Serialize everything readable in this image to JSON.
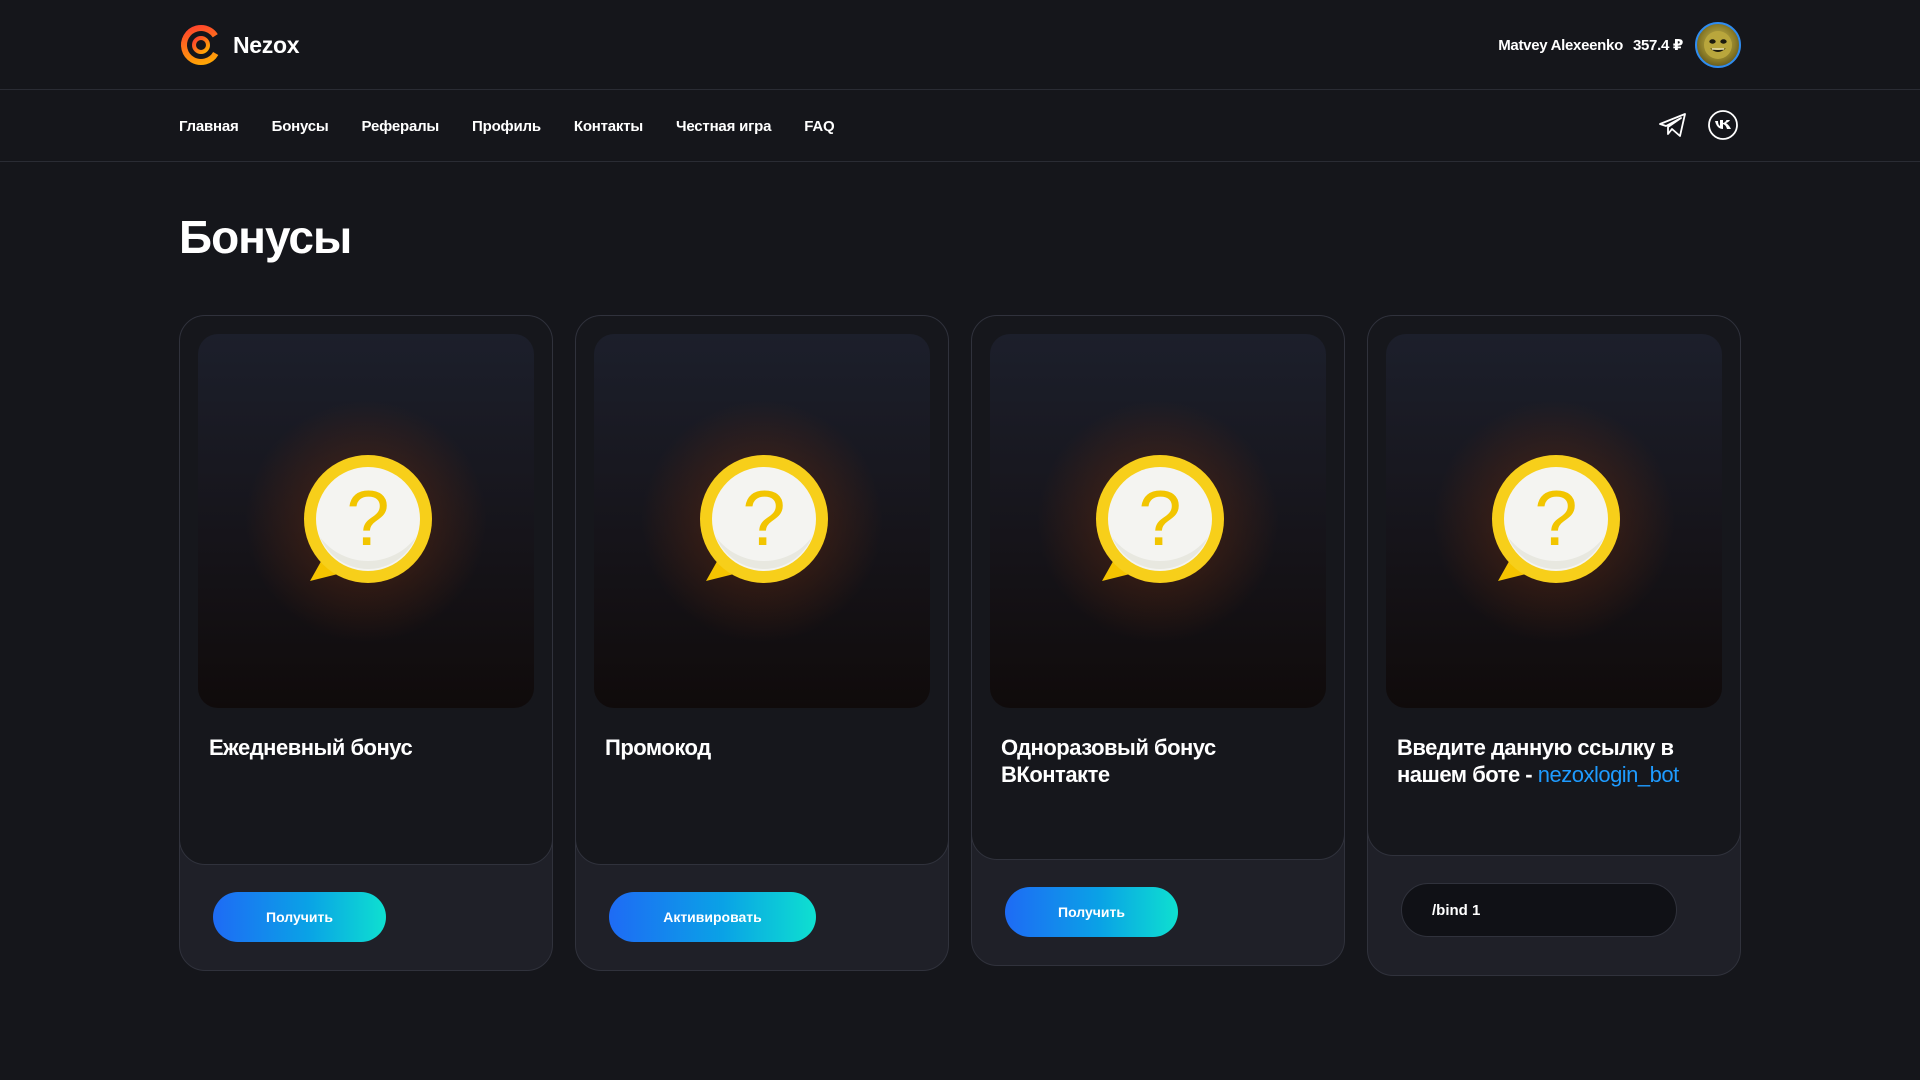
{
  "header": {
    "logo_text": "Nezox",
    "user_name": "Matvey Alexeenko",
    "balance": "357.4 ₽"
  },
  "nav": {
    "items": [
      "Главная",
      "Бонусы",
      "Рефералы",
      "Профиль",
      "Контакты",
      "Честная игра",
      "FAQ"
    ],
    "social_icons": [
      "telegram-icon",
      "vk-icon"
    ]
  },
  "page": {
    "title": "Бонусы"
  },
  "cards": [
    {
      "title": "Ежедневный бонус",
      "button_label": "Получить",
      "icon": "question-bubble-icon"
    },
    {
      "title": "Промокод",
      "button_label": "Активировать",
      "icon": "question-bubble-icon"
    },
    {
      "title": "Одноразовый бонус ВКонтакте",
      "button_label": "Получить",
      "icon": "question-bubble-icon"
    },
    {
      "title_prefix": "Введите данную ссылку в нашем боте - ",
      "title_link": "nezoxlogin_bot",
      "command_value": "/bind 1",
      "icon": "question-bubble-icon"
    }
  ],
  "colors": {
    "background": "#15161b",
    "accent_gradient_start": "#1e6bf5",
    "accent_gradient_end": "#0ee0d0",
    "link": "#1e9bff"
  }
}
